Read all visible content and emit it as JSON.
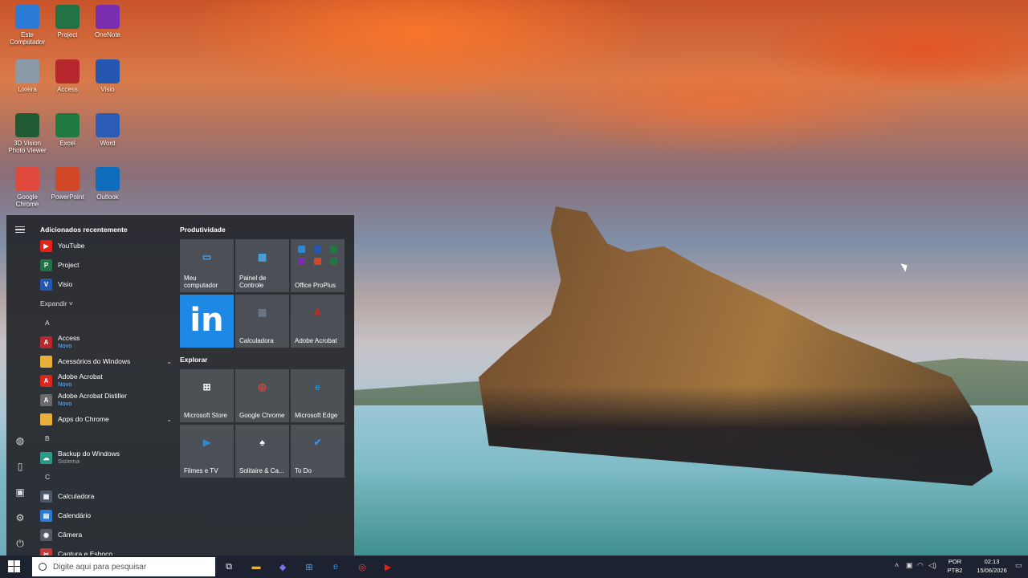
{
  "desktop": {
    "icons": [
      {
        "label": "Este Computador",
        "icon": "computer-icon",
        "color": "#2a7bd6"
      },
      {
        "label": "Project",
        "icon": "project-icon",
        "color": "#217346"
      },
      {
        "label": "OneNote",
        "icon": "onenote-icon",
        "color": "#7b2fb0"
      },
      {
        "label": "Lixeira",
        "icon": "recycle-bin-icon",
        "color": "#8a9aa8"
      },
      {
        "label": "Access",
        "icon": "access-icon",
        "color": "#b7282e"
      },
      {
        "label": "Visio",
        "icon": "visio-icon",
        "color": "#2657b0"
      },
      {
        "label": "3D Vision Photo Viewer",
        "icon": "3d-vision-icon",
        "color": "#1f5a33"
      },
      {
        "label": "Excel",
        "icon": "excel-icon",
        "color": "#1f7a3f"
      },
      {
        "label": "Word",
        "icon": "word-icon",
        "color": "#2b5cb5"
      },
      {
        "label": "Google Chrome",
        "icon": "chrome-icon",
        "color": "#e0493b"
      },
      {
        "label": "PowerPoint",
        "icon": "powerpoint-icon",
        "color": "#d24726"
      },
      {
        "label": "Outlook",
        "icon": "outlook-icon",
        "color": "#0f6cbd"
      }
    ]
  },
  "start_menu": {
    "recent_header": "Adicionados recentemente",
    "recent": [
      {
        "label": "YouTube",
        "icon": "youtube-icon",
        "color": "#e62117",
        "glyph": "▶"
      },
      {
        "label": "Project",
        "icon": "project-icon",
        "color": "#217346",
        "glyph": "P"
      },
      {
        "label": "Visio",
        "icon": "visio-icon",
        "color": "#2657b0",
        "glyph": "V"
      }
    ],
    "expand_label": "Expandir ˅",
    "letter_a": "A",
    "letter_b": "B",
    "letter_c": "C",
    "apps_a": [
      {
        "label": "Access",
        "sub": "Novo",
        "icon": "access-icon",
        "color": "#b7282e",
        "glyph": "A"
      },
      {
        "label": "Acessórios do Windows",
        "icon": "folder-icon",
        "color": "#e8b23a",
        "glyph": ""
      },
      {
        "label": "Adobe Acrobat",
        "sub": "Novo",
        "icon": "acrobat-icon",
        "color": "#d7261b",
        "glyph": "A"
      },
      {
        "label": "Adobe Acrobat Distiller",
        "sub": "Novo",
        "icon": "acrobat-distiller-icon",
        "color": "#6a6a6a",
        "glyph": "A"
      },
      {
        "label": "Apps do Chrome",
        "icon": "folder-icon",
        "color": "#e8b23a",
        "glyph": ""
      }
    ],
    "apps_b": [
      {
        "label": "Backup do Windows",
        "sub": "Sistema",
        "icon": "backup-icon",
        "color": "#2a9a8a",
        "glyph": "☁"
      }
    ],
    "apps_c": [
      {
        "label": "Calculadora",
        "icon": "calculator-icon",
        "color": "#4a5a6a",
        "glyph": "▦"
      },
      {
        "label": "Calendário",
        "icon": "calendar-icon",
        "color": "#2a7bd6",
        "glyph": "▤"
      },
      {
        "label": "Câmera",
        "icon": "camera-icon",
        "color": "#555c66",
        "glyph": "◉"
      },
      {
        "label": "Captura e Esboço",
        "icon": "snip-icon",
        "color": "#c03b3b",
        "glyph": "✂"
      }
    ],
    "productivity_title": "Produtividade",
    "explore_title": "Explorar",
    "tiles_productivity": [
      {
        "label": "Meu computador",
        "icon": "computer-icon",
        "color": "#4aa3e8",
        "glyph": "▭"
      },
      {
        "label": "Painel de Controle",
        "icon": "control-panel-icon",
        "color": "#4aa3e8",
        "glyph": "▦"
      },
      {
        "label": "Office ProPlus",
        "icon": "office-icon",
        "color": "#555",
        "glyph": ""
      },
      {
        "label": "",
        "icon": "linkedin-icon",
        "color": "#1e88e5",
        "glyph": "in"
      },
      {
        "label": "Calculadora",
        "icon": "calculator-icon",
        "color": "#6a7a8a",
        "glyph": "▦"
      },
      {
        "label": "Adobe Acrobat",
        "icon": "acrobat-icon",
        "color": "#d7261b",
        "glyph": "A"
      }
    ],
    "tiles_explore": [
      {
        "label": "Microsoft Store",
        "icon": "store-icon",
        "color": "#ffffff",
        "glyph": "⊞"
      },
      {
        "label": "Google Chrome",
        "icon": "chrome-icon",
        "color": "#e0493b",
        "glyph": "◎"
      },
      {
        "label": "Microsoft Edge",
        "icon": "edge-icon",
        "color": "#1f8fd8",
        "glyph": "e"
      },
      {
        "label": "Filmes e TV",
        "icon": "movies-icon",
        "color": "#2a8ad6",
        "glyph": "▶"
      },
      {
        "label": "Solitaire & Ca...",
        "icon": "solitaire-icon",
        "color": "#ffffff",
        "glyph": "♠"
      },
      {
        "label": "To Do",
        "icon": "todo-icon",
        "color": "#3d8ee6",
        "glyph": "✔"
      }
    ]
  },
  "taskbar": {
    "search_placeholder": "Digite aqui para pesquisar",
    "apps": [
      {
        "icon": "task-view-icon",
        "color": "#ffffff",
        "glyph": "⧉"
      },
      {
        "icon": "file-explorer-icon",
        "color": "#e8b23a",
        "glyph": "▬"
      },
      {
        "icon": "copilot-icon",
        "color": "#7c6ff0",
        "glyph": "◆"
      },
      {
        "icon": "store-icon",
        "color": "#5aa0e0",
        "glyph": "⊞"
      },
      {
        "icon": "edge-icon",
        "color": "#1f8fd8",
        "glyph": "e"
      },
      {
        "icon": "chrome-icon",
        "color": "#e0493b",
        "glyph": "◎"
      },
      {
        "icon": "youtube-icon",
        "color": "#e62117",
        "glyph": "▶"
      }
    ],
    "lang_top": "POR",
    "lang_bottom": "PTB2",
    "time": "02:13",
    "date": "15/06/2026"
  }
}
